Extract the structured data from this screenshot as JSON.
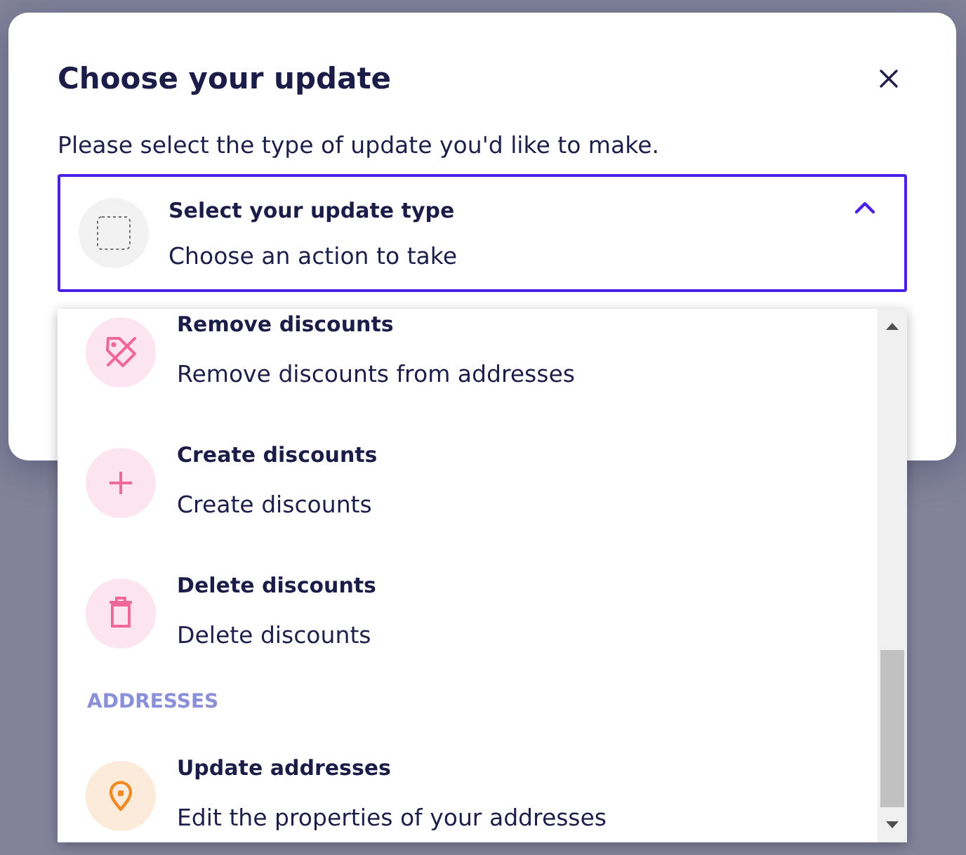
{
  "dialog": {
    "title": "Choose your update",
    "description": "Please select the type of update you'd like to make."
  },
  "select": {
    "title": "Select your update type",
    "subtitle": "Choose an action to take",
    "expanded": true
  },
  "dropdown": {
    "items": [
      {
        "kind": "remove",
        "title": "Remove discounts",
        "subtitle": "Remove discounts from addresses",
        "color": "#f0679a",
        "selected": false
      },
      {
        "kind": "create",
        "title": "Create discounts",
        "subtitle": "Create discounts",
        "color": "#f0679a",
        "selected": false
      },
      {
        "kind": "delete",
        "title": "Delete discounts",
        "subtitle": "Delete discounts",
        "color": "#f0679a",
        "selected": false
      },
      {
        "kind": "heading",
        "label": "ADDRESSES"
      },
      {
        "kind": "locate",
        "title": "Update addresses",
        "subtitle": "Edit the properties of your addresses",
        "color": "#f08a24",
        "selected": false
      }
    ]
  }
}
